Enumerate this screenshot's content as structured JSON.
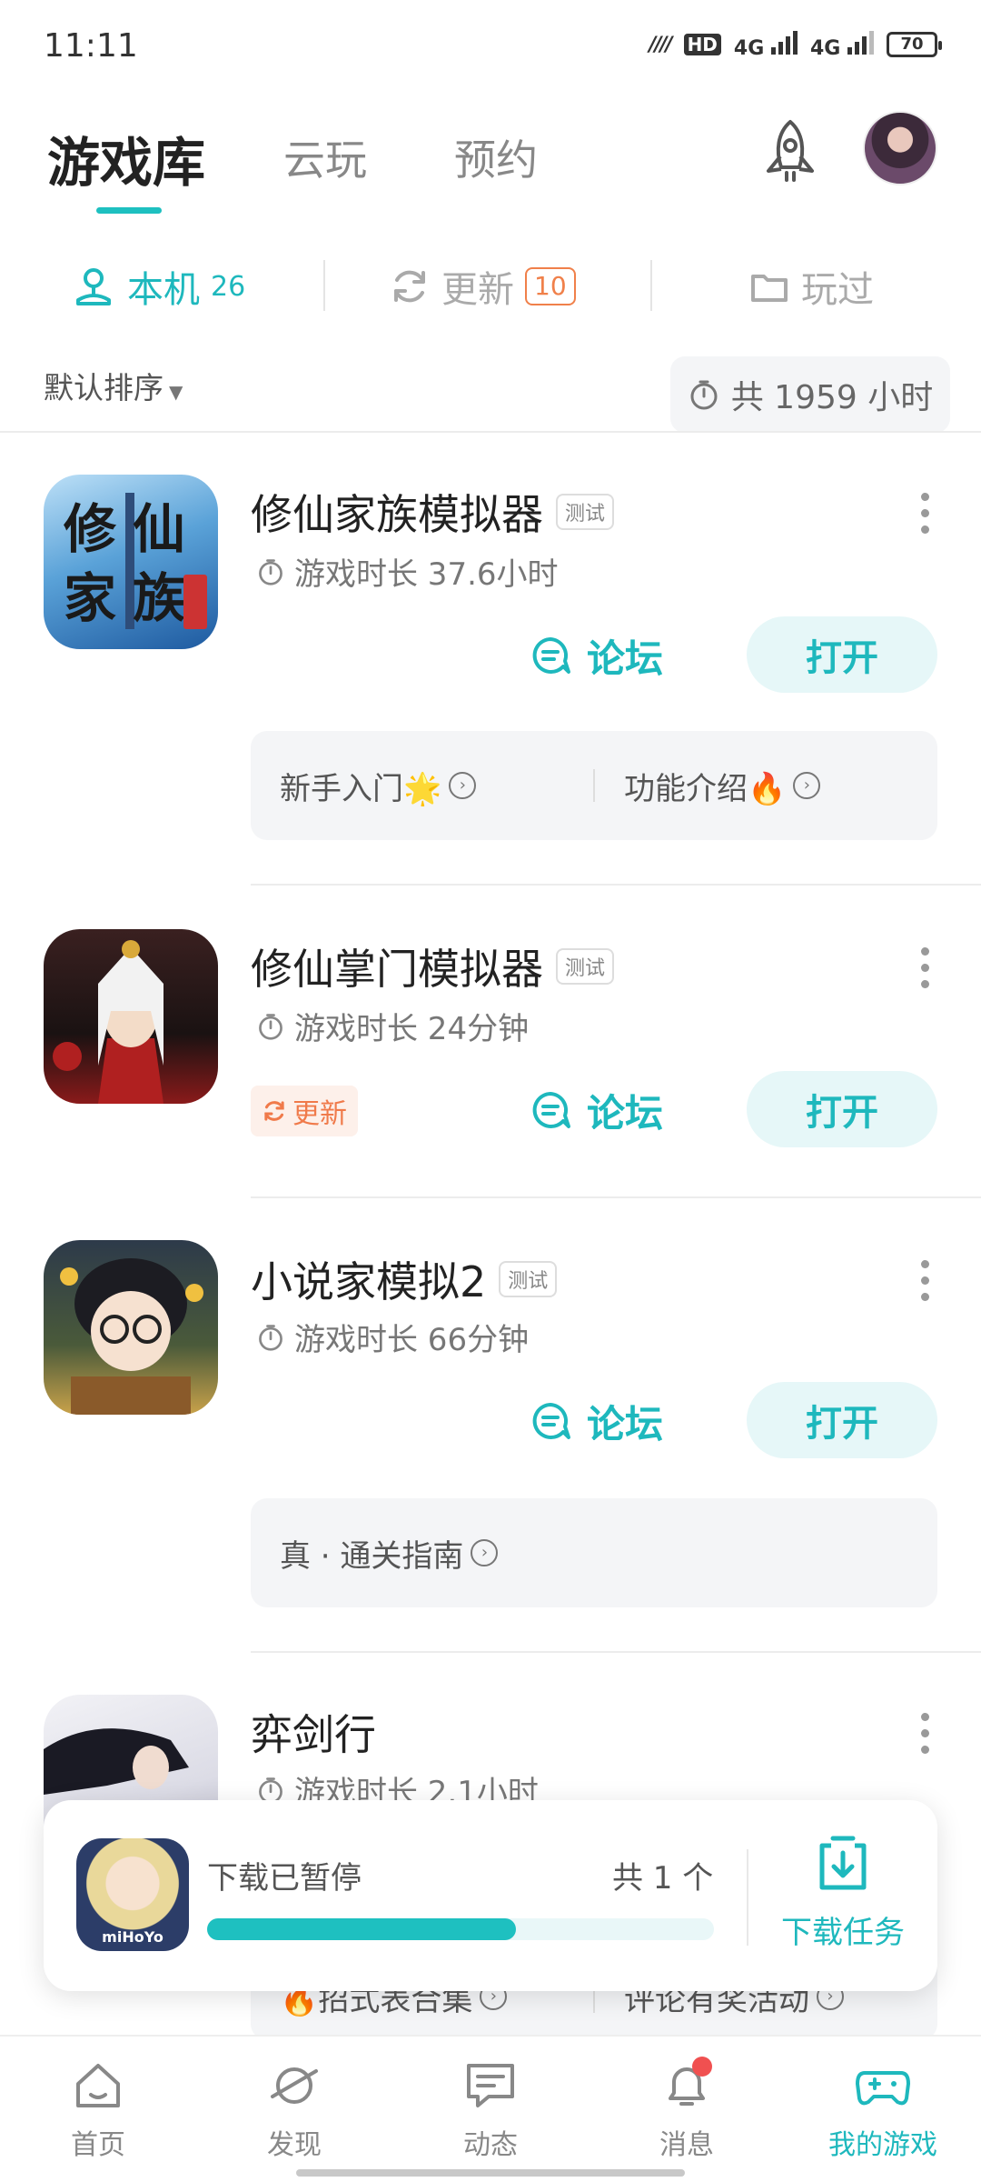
{
  "status_bar": {
    "time": "11:11",
    "battery": "70",
    "net1": "4G",
    "net2": "4G"
  },
  "top_tabs": [
    "游戏库",
    "云玩",
    "预约"
  ],
  "sub_tabs": {
    "local": {
      "label": "本机",
      "count": "26"
    },
    "update": {
      "label": "更新",
      "count": "10"
    },
    "played": {
      "label": "玩过"
    }
  },
  "sort": {
    "label": "默认排序",
    "total_time": "共 1959 小时"
  },
  "games": [
    {
      "title": "修仙家族模拟器",
      "tag": "测试",
      "play_time": "游戏时长 37.6小时",
      "forum": "论坛",
      "open": "打开",
      "guides": [
        "新手入门🌟",
        "功能介绍🔥"
      ]
    },
    {
      "title": "修仙掌门模拟器",
      "tag": "测试",
      "play_time": "游戏时长 24分钟",
      "forum": "论坛",
      "open": "打开",
      "update": "更新"
    },
    {
      "title": "小说家模拟2",
      "tag": "测试",
      "play_time": "游戏时长 66分钟",
      "forum": "论坛",
      "open": "打开",
      "guides": [
        "真 · 通关指南"
      ]
    },
    {
      "title": "弈剑行",
      "play_time": "游戏时长 2.1小时",
      "guides": [
        "🔥招式表合集",
        "评论有奖活动"
      ]
    }
  ],
  "download": {
    "status": "下载已暂停",
    "count": "共 1 个",
    "progress": 0.61,
    "task_label": "下载任务",
    "icon_text": "miHoYo"
  },
  "bottom_nav": [
    "首页",
    "发现",
    "动态",
    "消息",
    "我的游戏"
  ],
  "colors": {
    "accent": "#1ec0c0",
    "update": "#f07a4a",
    "badge_dot": "#f05050"
  }
}
